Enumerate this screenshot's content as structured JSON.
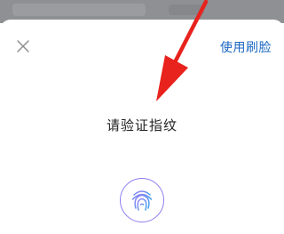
{
  "header": {
    "switch_method_label": "使用刷脸"
  },
  "main": {
    "prompt": "请验证指纹"
  },
  "colors": {
    "link": "#1a67c2",
    "annotation_arrow": "#e8221c",
    "fingerprint_ring": "#8c7ff0"
  },
  "icons": {
    "close": "close-icon",
    "fingerprint": "fingerprint-icon"
  }
}
